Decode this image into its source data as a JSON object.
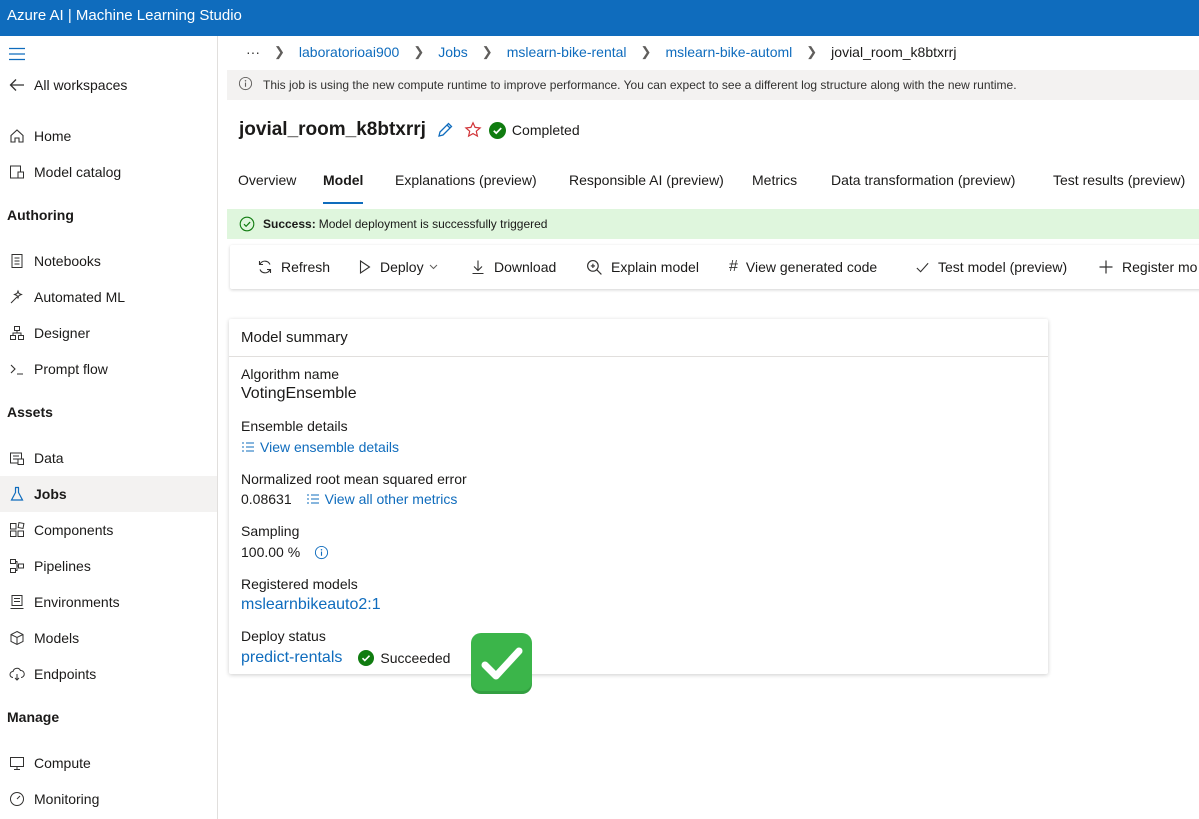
{
  "topbar": {
    "title": "Azure AI | Machine Learning Studio"
  },
  "sidebar": {
    "all_workspaces": "All workspaces",
    "home": "Home",
    "model_catalog": "Model catalog",
    "authoring_heading": "Authoring",
    "notebooks": "Notebooks",
    "automated_ml": "Automated ML",
    "designer": "Designer",
    "prompt_flow": "Prompt flow",
    "assets_heading": "Assets",
    "data": "Data",
    "jobs": "Jobs",
    "components": "Components",
    "pipelines": "Pipelines",
    "environments": "Environments",
    "models": "Models",
    "endpoints": "Endpoints",
    "manage_heading": "Manage",
    "compute": "Compute",
    "monitoring": "Monitoring"
  },
  "breadcrumb": {
    "overflow": "···",
    "items": [
      "laboratorioai900",
      "Jobs",
      "mslearn-bike-rental",
      "mslearn-bike-automl",
      "jovial_room_k8btxrrj"
    ]
  },
  "info_banner": "This job is using the new compute runtime to improve performance. You can expect to see a different log structure along with the new runtime.",
  "job": {
    "title": "jovial_room_k8btxrrj",
    "status": "Completed"
  },
  "tabs": [
    "Overview",
    "Model",
    "Explanations (preview)",
    "Responsible AI (preview)",
    "Metrics",
    "Data transformation (preview)",
    "Test results (preview)"
  ],
  "success_banner": {
    "label": "Success:",
    "message": "Model deployment is successfully triggered"
  },
  "toolbar": {
    "refresh": "Refresh",
    "deploy": "Deploy",
    "download": "Download",
    "explain": "Explain model",
    "view_code": "View generated code",
    "test_model": "Test model (preview)",
    "register": "Register mo"
  },
  "summary": {
    "title": "Model summary",
    "algorithm_label": "Algorithm name",
    "algorithm_value": "VotingEnsemble",
    "ensemble_label": "Ensemble details",
    "ensemble_link": "View ensemble details",
    "nrmse_label": "Normalized root mean squared error",
    "nrmse_value": "0.08631",
    "metrics_link": "View all other metrics",
    "sampling_label": "Sampling",
    "sampling_value": "100.00 %",
    "registered_label": "Registered models",
    "registered_link": "mslearnbikeauto2:1",
    "deploy_label": "Deploy status",
    "deploy_link": "predict-rentals",
    "deploy_status": "Succeeded"
  },
  "colors": {
    "brand": "#0f6cbd",
    "success": "#107c10",
    "success_bg": "#dff6dd",
    "star": "#d13438"
  }
}
